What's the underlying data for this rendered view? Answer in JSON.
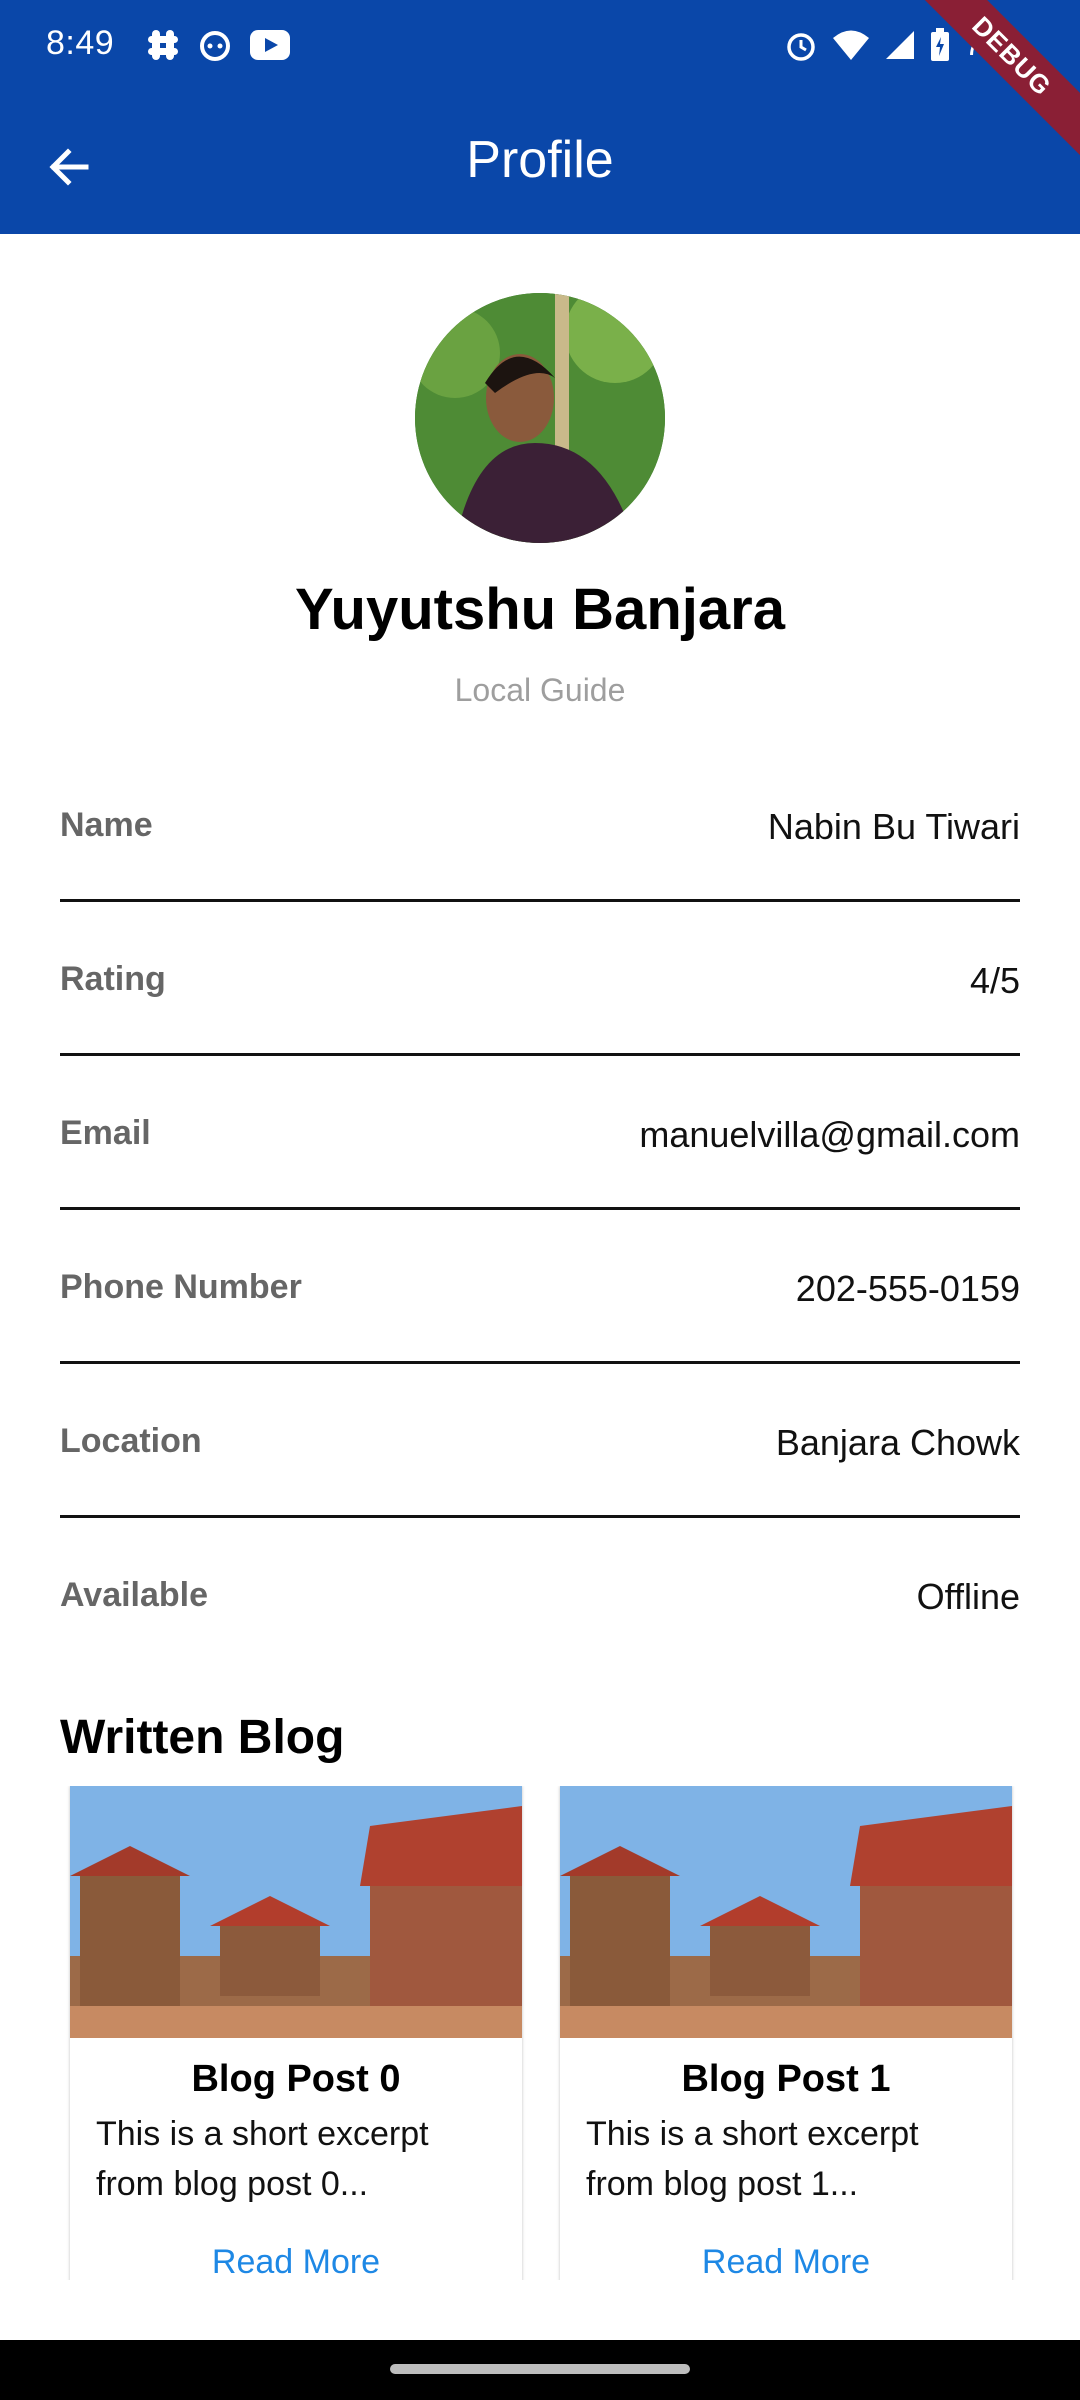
{
  "status_bar": {
    "time": "8:49",
    "battery_text": "78",
    "debug_banner": "DEBUG"
  },
  "app_bar": {
    "title": "Profile"
  },
  "profile": {
    "name": "Yuyutshu Banjara",
    "role": "Local Guide"
  },
  "info_rows": [
    {
      "label": "Name",
      "value": "Nabin Bu Tiwari"
    },
    {
      "label": "Rating",
      "value": "4/5"
    },
    {
      "label": "Email",
      "value": "manuelvilla@gmail.com"
    },
    {
      "label": "Phone Number",
      "value": "202-555-0159"
    },
    {
      "label": "Location",
      "value": "Banjara Chowk"
    },
    {
      "label": "Available",
      "value": "Offline"
    }
  ],
  "blog": {
    "section_title": "Written Blog",
    "posts": [
      {
        "title": "Blog Post 0",
        "excerpt": "This is a short excerpt from blog post 0...",
        "link": "Read More"
      },
      {
        "title": "Blog Post 1",
        "excerpt": "This is a short excerpt from blog post 1...",
        "link": "Read More"
      }
    ]
  },
  "colors": {
    "app_bar": "#0a47a9",
    "link": "#1e88e5",
    "debug_ribbon": "#8a1f35"
  }
}
